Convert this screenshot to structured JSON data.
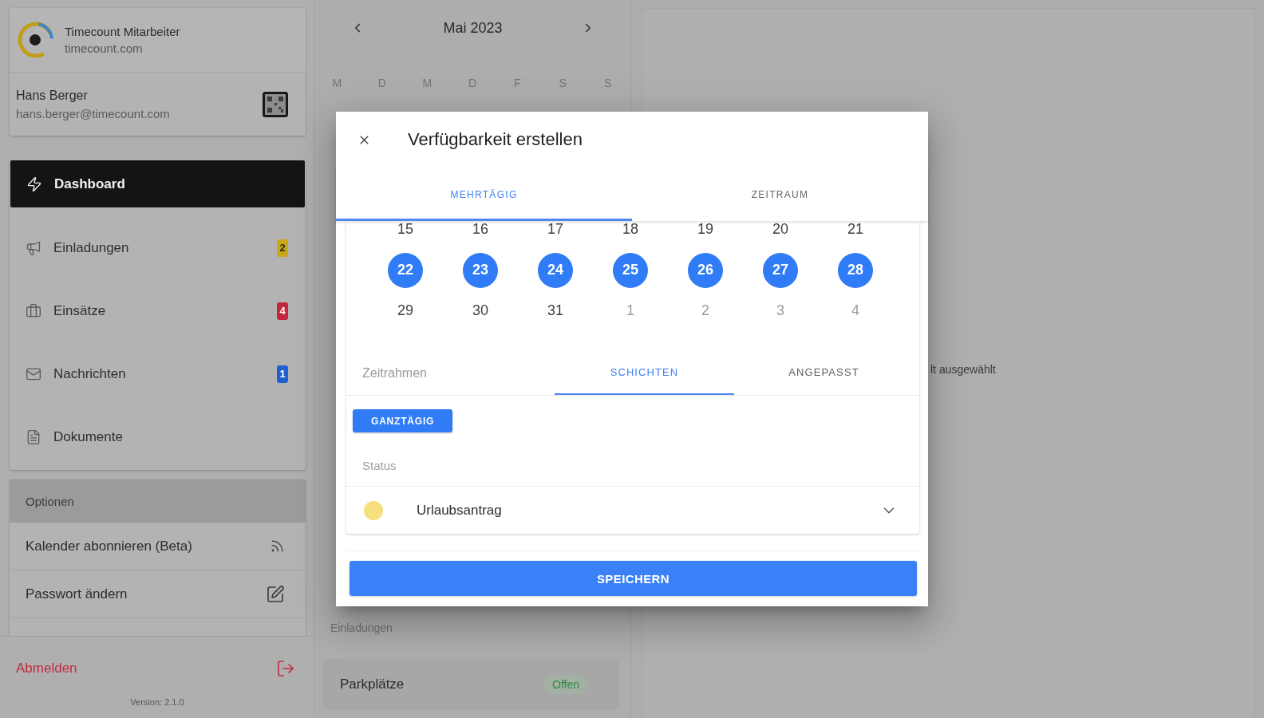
{
  "sidebar": {
    "app": {
      "title": "Timecount Mitarbeiter",
      "subtitle": "timecount.com"
    },
    "user": {
      "name": "Hans Berger",
      "email": "hans.berger@timecount.com"
    },
    "nav": [
      {
        "label": "Dashboard",
        "selected": true
      },
      {
        "label": "Einladungen",
        "selected": false,
        "badge": {
          "count": "2",
          "color": "#c9a616"
        }
      },
      {
        "label": "Einsätze",
        "selected": false,
        "badge": {
          "count": "4",
          "color": "#c1283c"
        }
      },
      {
        "label": "Nachrichten",
        "selected": false,
        "badge": {
          "count": "1",
          "color": "#1f5fce"
        }
      },
      {
        "label": "Dokumente",
        "selected": false
      }
    ],
    "options": {
      "title": "Optionen",
      "items": [
        {
          "label": "Kalender abonnieren (Beta)"
        },
        {
          "label": "Passwort ändern"
        }
      ]
    },
    "logout": "Abmelden",
    "version": "Version: 2.1.0"
  },
  "calendar": {
    "month": "Mai 2023",
    "weekdays": [
      "M",
      "D",
      "M",
      "D",
      "F",
      "S",
      "S"
    ],
    "section": {
      "title": "Einladungen",
      "items": [
        {
          "name": "Parkplätze",
          "status": "Offen"
        }
      ]
    }
  },
  "detail": {
    "message": "lt ausgewählt"
  },
  "dialog": {
    "title": "Verfügbarkeit erstellen",
    "tabs": [
      {
        "label": "MEHRTÄGIG",
        "selected": true
      },
      {
        "label": "ZEITRAUM",
        "selected": false
      }
    ],
    "weeks": [
      {
        "days": [
          {
            "day": "15",
            "selected": false,
            "other_month": false
          },
          {
            "day": "16",
            "selected": false,
            "other_month": false
          },
          {
            "day": "17",
            "selected": false,
            "other_month": false
          },
          {
            "day": "18",
            "selected": false,
            "other_month": false
          },
          {
            "day": "19",
            "selected": false,
            "other_month": false
          },
          {
            "day": "20",
            "selected": false,
            "other_month": false
          },
          {
            "day": "21",
            "selected": false,
            "other_month": false
          }
        ]
      },
      {
        "days": [
          {
            "day": "22",
            "selected": true,
            "other_month": false
          },
          {
            "day": "23",
            "selected": true,
            "other_month": false
          },
          {
            "day": "24",
            "selected": true,
            "other_month": false
          },
          {
            "day": "25",
            "selected": true,
            "other_month": false
          },
          {
            "day": "26",
            "selected": true,
            "other_month": false
          },
          {
            "day": "27",
            "selected": true,
            "other_month": false
          },
          {
            "day": "28",
            "selected": true,
            "other_month": false
          }
        ]
      },
      {
        "days": [
          {
            "day": "29",
            "selected": false,
            "other_month": false
          },
          {
            "day": "30",
            "selected": false,
            "other_month": false
          },
          {
            "day": "31",
            "selected": false,
            "other_month": false
          },
          {
            "day": "1",
            "selected": false,
            "other_month": true
          },
          {
            "day": "2",
            "selected": false,
            "other_month": true
          },
          {
            "day": "3",
            "selected": false,
            "other_month": true
          },
          {
            "day": "4",
            "selected": false,
            "other_month": true
          }
        ]
      }
    ],
    "time_frame": {
      "label": "Zeitrahmen",
      "tabs": [
        {
          "label": "SCHICHTEN",
          "selected": true
        },
        {
          "label": "ANGEPASST",
          "selected": false
        }
      ]
    },
    "shifts": [
      {
        "label": "GANZTÄGIG",
        "selected": true
      }
    ],
    "status": {
      "label": "Status",
      "value": "Urlaubsantrag",
      "color": "#f6df7c"
    },
    "save": "SPEICHERN"
  }
}
